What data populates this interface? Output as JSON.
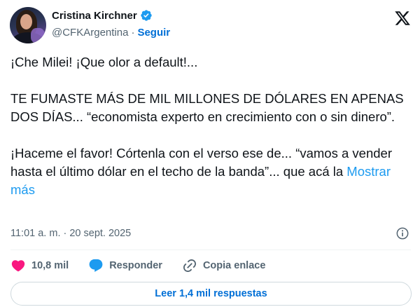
{
  "author": {
    "name": "Cristina Kirchner",
    "handle": "@CFKArgentina",
    "separator": "·",
    "follow_label": "Seguir",
    "verified_color": "#1d9bf0"
  },
  "tweet": {
    "line1": "¡Che Milei! ¡Que olor a default!...",
    "para2": "TE FUMASTE MÁS DE MIL MILLONES DE DÓLARES EN APENAS DOS DÍAS... “economista experto en crecimiento con o sin dinero”.",
    "para3": "¡Haceme el favor! Córtenla con el verso ese de... “vamos a vender hasta el último dólar en el techo de la banda”... que acá la",
    "show_more": "Mostrar más"
  },
  "timestamp": "11:01 a. m. · 20 sept. 2025",
  "actions": {
    "like_count": "10,8 mil",
    "reply_label": "Responder",
    "copy_label": "Copia enlace"
  },
  "replies_button": "Leer 1,4 mil respuestas",
  "colors": {
    "like": "#f91880",
    "reply": "#1d9bf0",
    "link": "#006fd6",
    "secondary_text": "#536471"
  },
  "icons": {
    "avatar": "profile-photo",
    "verified": "verified-badge-icon",
    "logo": "x-logo-icon",
    "info": "info-icon",
    "like": "heart-icon",
    "reply": "speech-bubble-icon",
    "copy": "link-icon"
  }
}
